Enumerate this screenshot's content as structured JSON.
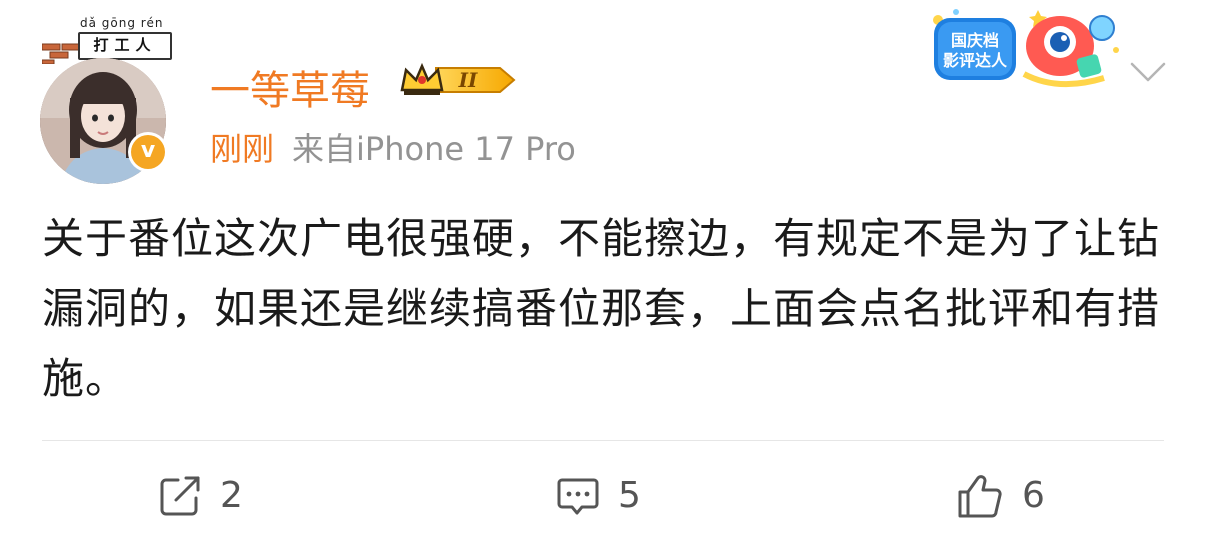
{
  "header": {
    "frame_tag": {
      "pinyin": "dǎ gōng rén",
      "chars": "打工人"
    },
    "username": "一等草莓",
    "vip_level": "II",
    "time": "刚刚",
    "source": "来自iPhone 17 Pro",
    "event_badge": {
      "line1": "国庆档",
      "line2": "影评达人"
    },
    "verified_mark": "v"
  },
  "post": {
    "text": "关于番位这次广电很强硬，不能擦边，有规定不是为了让钻漏洞的，如果还是继续搞番位那套，上面会点名批评和有措施。"
  },
  "actions": {
    "repost_count": "2",
    "comment_count": "5",
    "like_count": "6"
  },
  "icons": {
    "repost": "share-edit-icon",
    "comment": "comment-icon",
    "like": "thumbs-up-icon",
    "menu": "chevron-down-icon"
  },
  "colors": {
    "username": "#f07a23",
    "time": "#f07a23",
    "source": "#939393",
    "body_text": "#1a1a1a",
    "action_text": "#555555",
    "verified": "#f5a623"
  }
}
